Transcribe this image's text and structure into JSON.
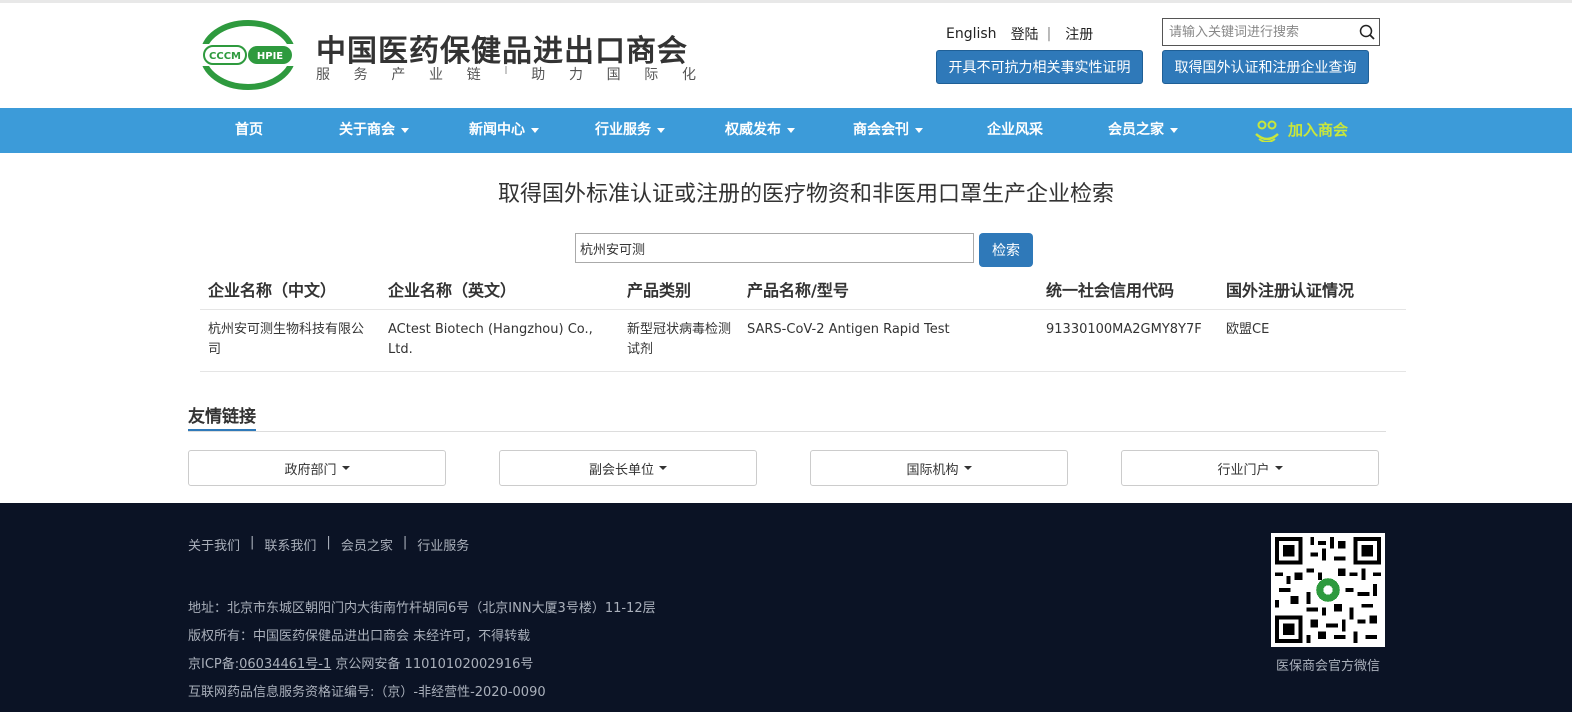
{
  "header": {
    "logo_text": "CCCM HPIE",
    "site_name": "中国医药保健品进出口商会",
    "slogan_left": [
      "服",
      "务",
      "产",
      "业",
      "链"
    ],
    "slogan_sep": "I",
    "slogan_right": [
      "助",
      "力",
      "国",
      "际",
      "化"
    ],
    "link_english": "English",
    "link_login": "登陆",
    "link_sep": "|",
    "link_register": "注册",
    "search_placeholder": "请输入关键词进行搜索",
    "btn_certificate": "开具不可抗力相关事实性证明",
    "btn_query": "取得国外认证和注册企业查询"
  },
  "nav": {
    "items": [
      {
        "label": "首页"
      },
      {
        "label": "关于商会"
      },
      {
        "label": "新闻中心"
      },
      {
        "label": "行业服务"
      },
      {
        "label": "权威发布"
      },
      {
        "label": "商会会刊"
      },
      {
        "label": "企业风采"
      },
      {
        "label": "会员之家"
      }
    ],
    "join": "加入商会"
  },
  "main": {
    "title": "取得国外标准认证或注册的医疗物资和非医用口罩生产企业检索",
    "query_value": "杭州安可测",
    "query_button": "检索",
    "table": {
      "headers": [
        "企业名称（中文）",
        "企业名称（英文）",
        "产品类别",
        "产品名称/型号",
        "统一社会信用代码",
        "国外注册认证情况"
      ],
      "rows": [
        [
          "杭州安可测生物科技有限公司",
          "ACtest Biotech (Hangzhou) Co., Ltd.",
          "新型冠状病毒检测试剂",
          "SARS-CoV-2 Antigen Rapid Test",
          "91330100MA2GMY8Y7F",
          "欧盟CE"
        ]
      ]
    }
  },
  "links": {
    "title": "友情链接",
    "buttons": [
      "政府部门",
      "副会长单位",
      "国际机构",
      "行业门户"
    ]
  },
  "footer": {
    "links": [
      "关于我们",
      "联系我们",
      "会员之家",
      "行业服务"
    ],
    "link_sep": "|",
    "address": "地址：北京市东城区朝阳门内大街南竹杆胡同6号（北京INN大厦3号楼）11-12层",
    "copyright": "版权所有：中国医药保健品进出口商会 未经许可，不得转载",
    "icp_prefix": "京ICP备:",
    "icp_number": "06034461号-1",
    "icp_suffix": " 京公网安备 11010102002916号",
    "license": "互联网药品信息服务资格证编号:（京）-非经营性-2020-0090",
    "qr_label": "医保商会官方微信"
  },
  "colors": {
    "nav_bg": "#3c9bd9",
    "button_blue": "#2f79b9",
    "logo_green": "#2e9a3e",
    "join_green": "#c8e63c",
    "footer_bg": "#0b1325"
  }
}
